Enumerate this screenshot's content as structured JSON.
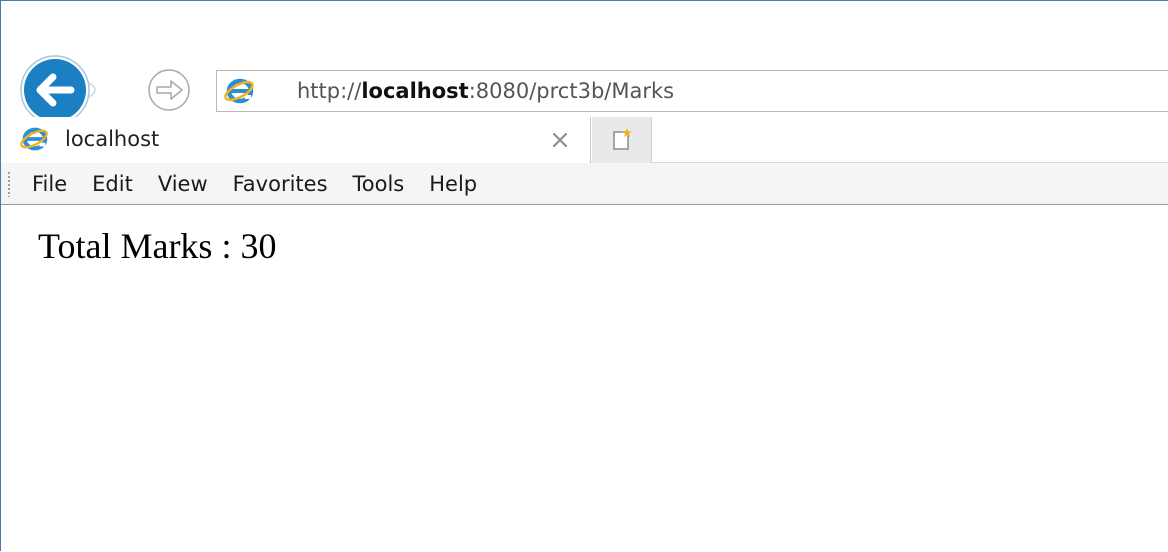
{
  "browser": {
    "address_bar": {
      "url_prefix": "http://",
      "url_host": "localhost",
      "url_rest": ":8080/prct3b/Marks"
    },
    "tab": {
      "title": "localhost"
    },
    "menu": {
      "items": [
        "File",
        "Edit",
        "View",
        "Favorites",
        "Tools",
        "Help"
      ]
    },
    "icons": {
      "back": "back-arrow-icon",
      "forward": "forward-arrow-icon",
      "page": "ie-logo-icon",
      "close": "close-icon",
      "new_tab": "new-tab-icon"
    },
    "colors": {
      "accent": "#1b7fc4",
      "frame": "#4a7ab5",
      "menu_bg": "#f5f5f5"
    }
  },
  "page": {
    "content_text": "Total Marks : 30"
  }
}
